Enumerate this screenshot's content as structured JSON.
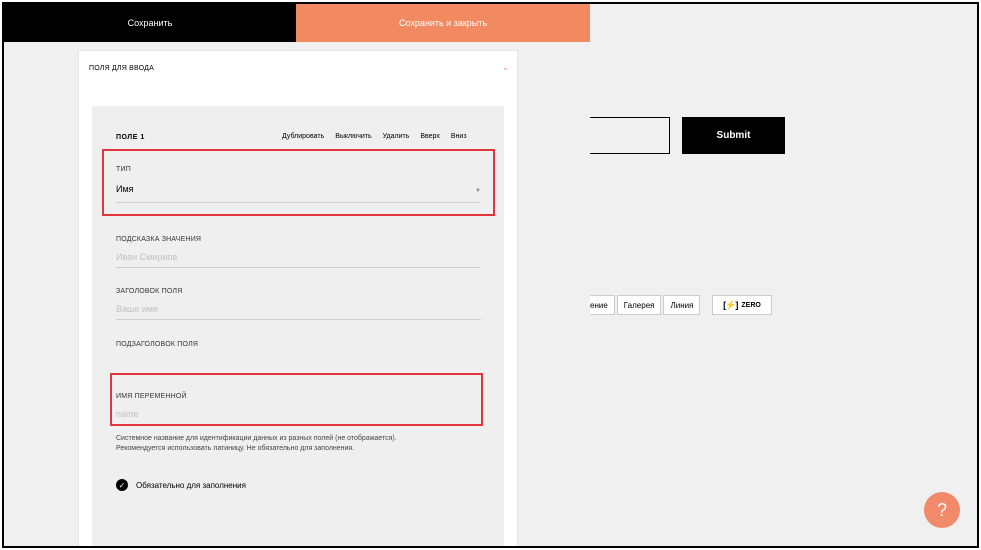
{
  "topbar": {
    "save_label": "Сохранить",
    "save_close_label": "Сохранить и закрыть"
  },
  "card": {
    "title": "ПОЛЯ ДЛЯ ВВОДА",
    "chevron_icon": "chevron-down-icon"
  },
  "field": {
    "title": "ПОЛЕ 1",
    "actions": [
      "Дублировать",
      "Выключить",
      "Удалить",
      "Вверх",
      "Вниз"
    ],
    "type_label": "ТИП",
    "type_value": "Имя",
    "hint_label": "ПОДСКАЗКА ЗНАЧЕНИЯ",
    "hint_placeholder": "Иван Смирнов",
    "title_label": "ЗАГОЛОВОК ПОЛЯ",
    "title_placeholder": "Ваше имя",
    "subtitle_label": "ПОДЗАГОЛОВОК ПОЛЯ",
    "varname_label": "ИМЯ ПЕРЕМЕННОЙ",
    "varname_placeholder": "name",
    "varname_hint_line1": "Системное название для идентификации данных из разных полей (не отображается).",
    "varname_hint_line2": "Рекомендуется использовать латиницу. Не обязательно для заполнения.",
    "required_label": "Обязательно для заполнения",
    "required_checked": true
  },
  "background": {
    "submit_label": "Submit",
    "tabs": [
      "ение",
      "Галерея",
      "Линия"
    ],
    "zero_label": "ZERO",
    "help_label": "?"
  },
  "colors": {
    "accent": "#f28a61",
    "highlight": "#e0383a",
    "help": "#f08a6a"
  }
}
